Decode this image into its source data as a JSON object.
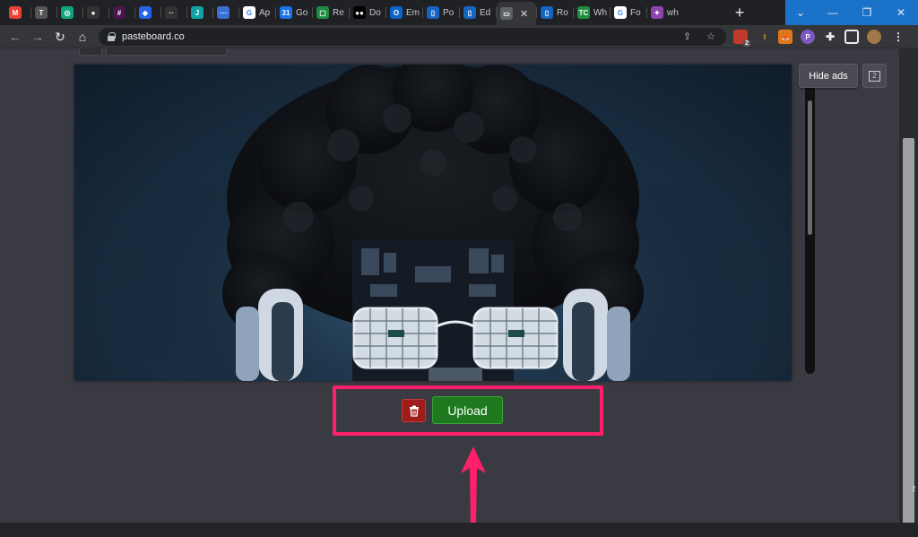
{
  "browser": {
    "tabs": [
      {
        "label": "",
        "icon": "gmail-icon",
        "color": "#ea4335",
        "glyph": "M"
      },
      {
        "label": "",
        "icon": "tab-icon",
        "color": "#555",
        "glyph": "T"
      },
      {
        "label": "",
        "icon": "chatgpt-icon",
        "color": "#10a37f",
        "glyph": "◎"
      },
      {
        "label": "",
        "icon": "github-icon",
        "color": "#333",
        "glyph": "●"
      },
      {
        "label": "",
        "icon": "slack-icon",
        "color": "#4a154b",
        "glyph": "#"
      },
      {
        "label": "",
        "icon": "diamond-icon",
        "color": "#2563eb",
        "glyph": "◆"
      },
      {
        "label": "",
        "icon": "dots-icon",
        "color": "#333",
        "glyph": "··"
      },
      {
        "label": "",
        "icon": "j-icon",
        "color": "#0fa3a3",
        "glyph": "J"
      },
      {
        "label": "",
        "icon": "more-icon",
        "color": "#3b6fd4",
        "glyph": "⋯"
      },
      {
        "label": "Ap",
        "icon": "google-icon",
        "color": "#ffffff",
        "glyph": "G"
      },
      {
        "label": "Go",
        "icon": "calendar-icon",
        "color": "#1a73e8",
        "glyph": "31"
      },
      {
        "label": "Re",
        "icon": "page-icon",
        "color": "#1e8e3e",
        "glyph": "▢"
      },
      {
        "label": "Do",
        "icon": "medium-icon",
        "color": "#000",
        "glyph": "●●"
      },
      {
        "label": "Em",
        "icon": "outlook-icon",
        "color": "#0a64c8",
        "glyph": "O"
      },
      {
        "label": "Po",
        "icon": "trello-icon",
        "color": "#1565c0",
        "glyph": "▯"
      },
      {
        "label": "Ed",
        "icon": "trello-icon",
        "color": "#1565c0",
        "glyph": "▯"
      },
      {
        "label": "",
        "icon": "monitor-icon",
        "color": "#5f6368",
        "glyph": "▭"
      },
      {
        "label": "Ro",
        "icon": "trello-icon",
        "color": "#1565c0",
        "glyph": "▯"
      },
      {
        "label": "Wh",
        "icon": "tc-icon",
        "color": "#1e8e3e",
        "glyph": "TC"
      },
      {
        "label": "Fo",
        "icon": "google-icon",
        "color": "#ffffff",
        "glyph": "G"
      },
      {
        "label": "wh",
        "icon": "ai-icon",
        "color": "#8e44ad",
        "glyph": "✦"
      }
    ],
    "active_tab_index": 16,
    "new_tab_glyph": "+",
    "url": "pasteboard.co",
    "extension_badge": "2"
  },
  "page": {
    "hide_ads_label": "Hide ads",
    "ad_counter": "2",
    "upload_label": "Upload",
    "scroll_number": "2"
  },
  "colors": {
    "highlight": "#ff1f6a",
    "upload_green": "#1f7a1f",
    "delete_red": "#9e1c1c",
    "window_accent": "#1a73c8"
  }
}
